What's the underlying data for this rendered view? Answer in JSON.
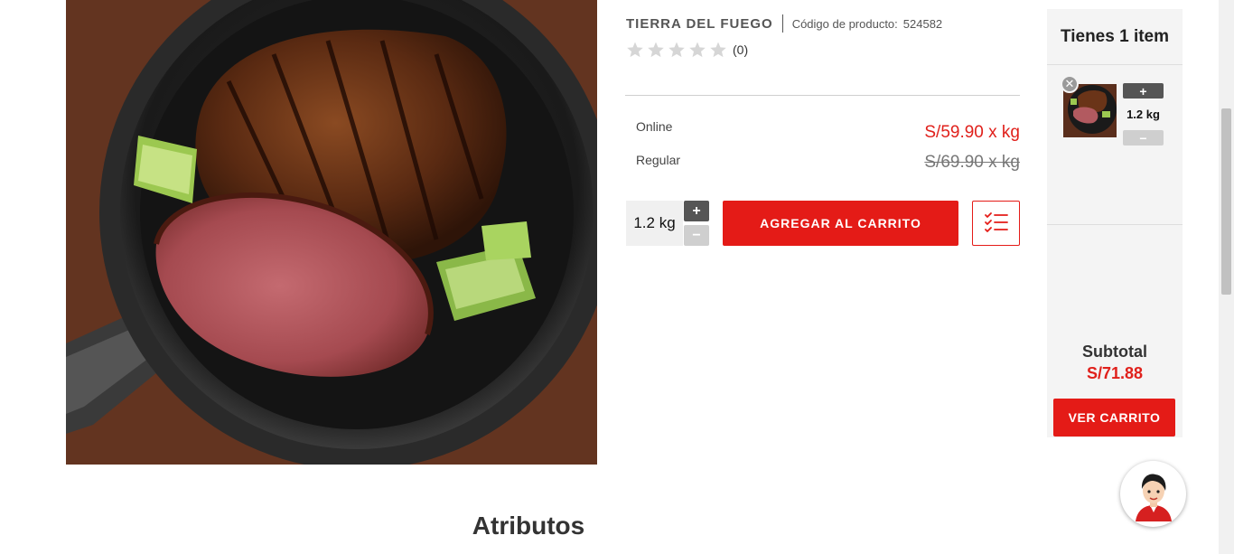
{
  "product": {
    "brand": "TIERRA DEL FUEGO",
    "code_label": "Código de producto:",
    "code_value": "524582",
    "rating_stars": 0,
    "rating_max": 5,
    "rating_count": "(0)",
    "image_alt": "steak-in-cast-iron-pan"
  },
  "prices": {
    "online_label": "Online",
    "online_value": "S/59.90 x kg",
    "regular_label": "Regular",
    "regular_value": "S/69.90 x kg"
  },
  "purchase": {
    "quantity": "1.2 kg",
    "plus_label": "+",
    "minus_label": "−",
    "add_to_cart_label": "AGREGAR AL CARRITO",
    "list_icon": "checklist-icon"
  },
  "cart": {
    "header": "Tienes 1 item",
    "items": [
      {
        "quantity": "1.2 kg",
        "remove_label": "✕",
        "plus_label": "+",
        "minus_label": "−"
      }
    ],
    "subtotal_label": "Subtotal",
    "subtotal_value": "S/71.88",
    "view_cart_label": "VER CARRITO"
  },
  "sections": {
    "attributes_title": "Atributos"
  },
  "colors": {
    "accent": "#e41b17",
    "price_red": "#e0201b",
    "panel_bg": "#f4f4f4"
  }
}
